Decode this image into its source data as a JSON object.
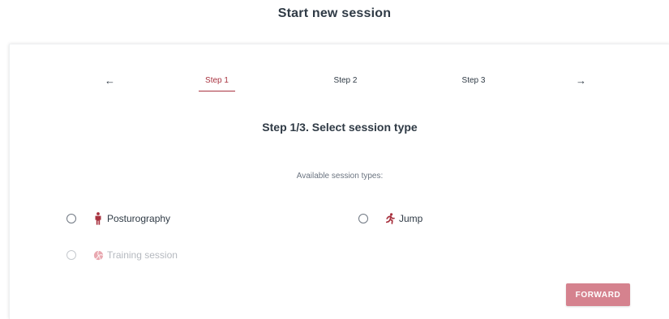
{
  "page": {
    "title": "Start new session"
  },
  "stepper": {
    "prev_arrow": "←",
    "next_arrow": "→",
    "steps": [
      {
        "label": "Step 1",
        "active": true
      },
      {
        "label": "Step 2",
        "active": false
      },
      {
        "label": "Step 3",
        "active": false
      }
    ]
  },
  "content": {
    "heading": "Step 1/3. Select session type",
    "available_label": "Available session types:",
    "options": [
      {
        "label": "Posturography",
        "icon": "standing-person-icon",
        "enabled": true,
        "selected": false
      },
      {
        "label": "Jump",
        "icon": "running-person-icon",
        "enabled": true,
        "selected": false
      },
      {
        "label": "Training session",
        "icon": "volleyball-icon",
        "enabled": false,
        "selected": false
      }
    ]
  },
  "actions": {
    "forward_label": "FORWARD"
  },
  "colors": {
    "accent": "#a8323f",
    "button_disabled": "#d5828e",
    "text": "#2f3a45",
    "muted": "#6b7480"
  }
}
